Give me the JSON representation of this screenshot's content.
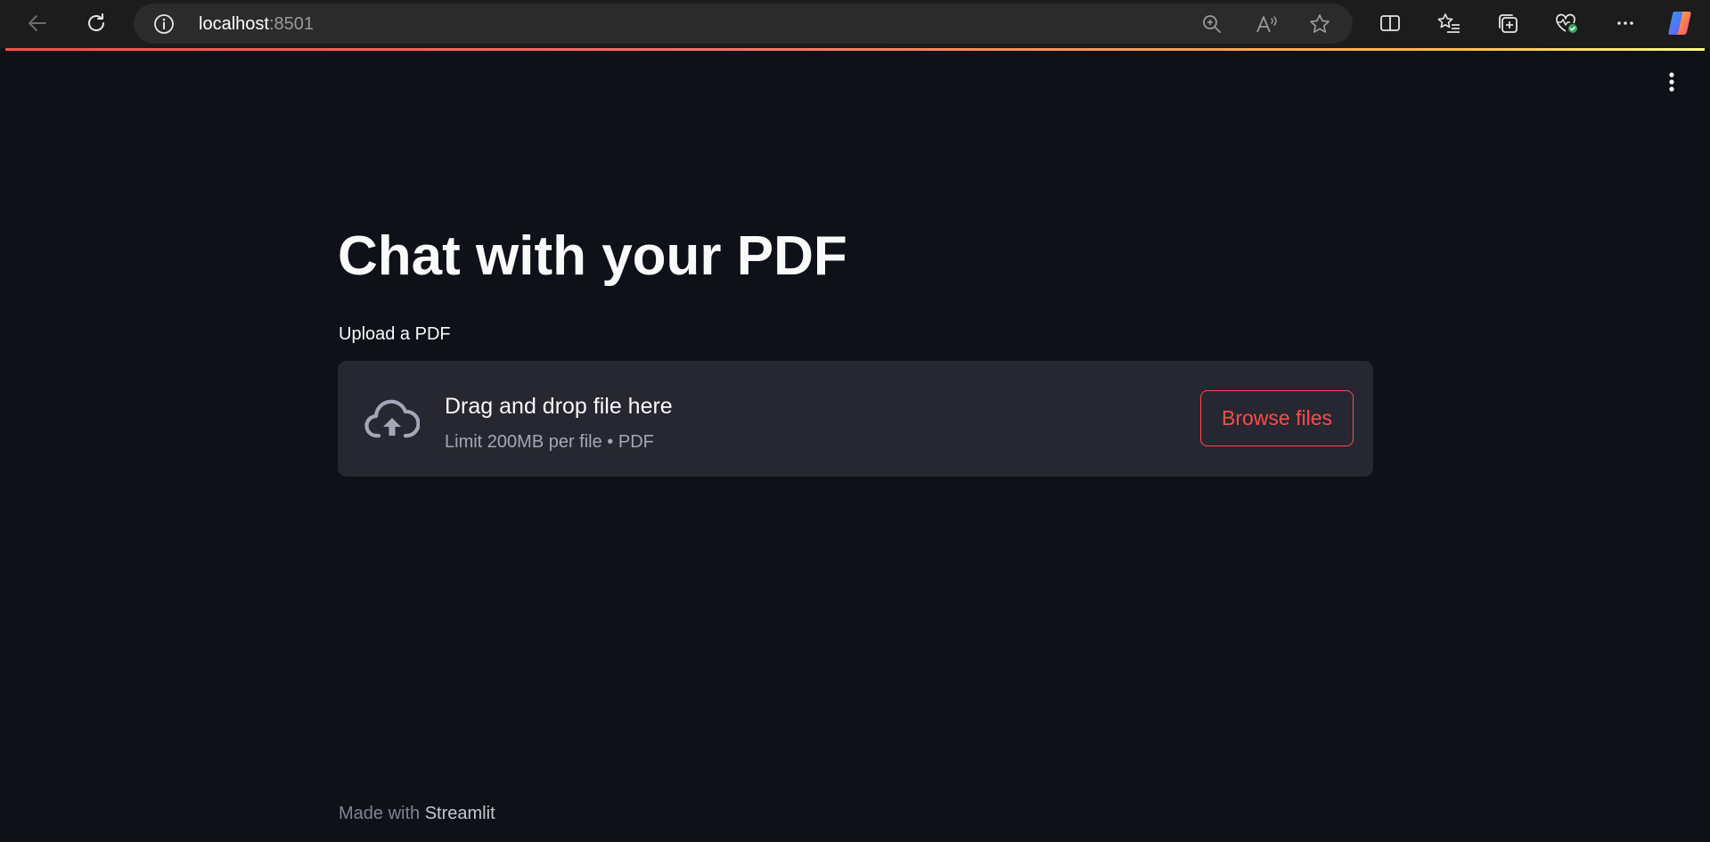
{
  "browser": {
    "url_host": "localhost",
    "url_port": ":8501",
    "icons": {
      "back": "arrow-left-icon",
      "refresh": "refresh-icon",
      "site_info": "info-icon",
      "zoom": "zoom-in-icon",
      "read_aloud": "read-aloud-icon",
      "favorite": "star-icon",
      "split_screen": "split-screen-icon",
      "favorites": "favorites-list-icon",
      "collections": "collections-icon",
      "browser_essentials": "heart-pulse-icon",
      "more": "ellipsis-icon",
      "copilot": "copilot-icon"
    }
  },
  "app": {
    "title": "Chat with your PDF",
    "uploader": {
      "label": "Upload a PDF",
      "drop_text": "Drag and drop file here",
      "limit_text": "Limit 200MB per file • PDF",
      "browse_label": "Browse files",
      "icon": "cloud-upload-icon"
    },
    "menu_icon": "vertical-ellipsis-icon",
    "footer": {
      "prefix": "Made with ",
      "brand": "Streamlit"
    }
  },
  "colors": {
    "background": "#0e1117",
    "dropzone": "#262730",
    "accent": "#ff4b4b",
    "text": "#fafafa",
    "muted": "#a3a8b8"
  }
}
